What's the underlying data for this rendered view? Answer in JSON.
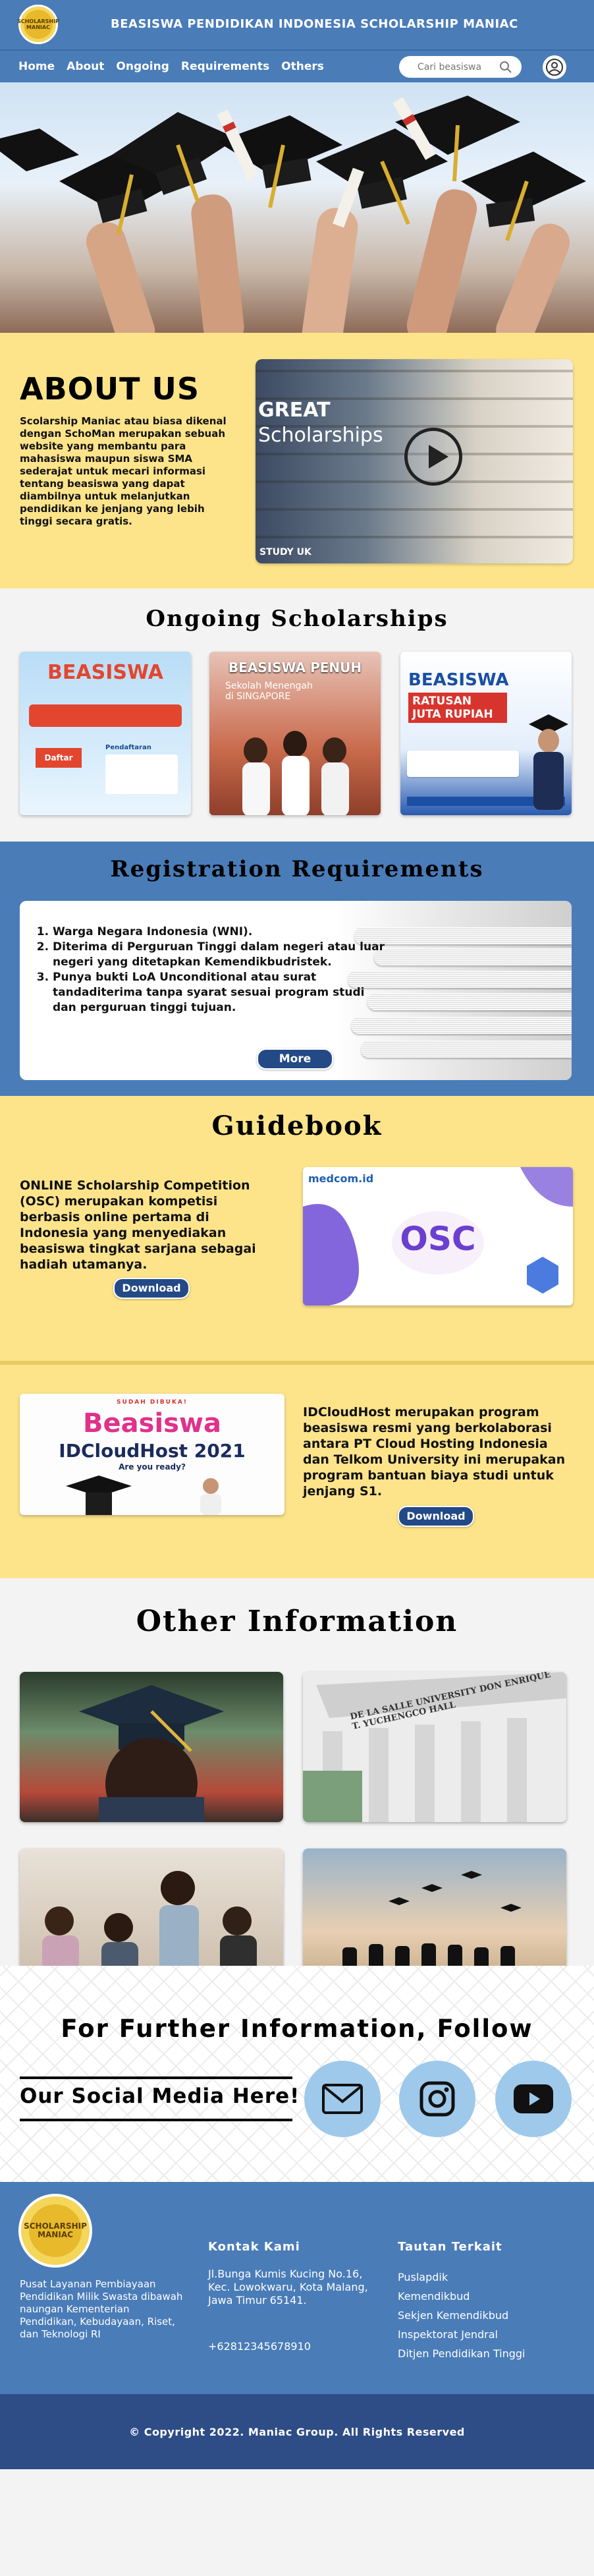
{
  "header": {
    "logo_text": "SCHOLARSHIP MANIAC",
    "site_title": "BEASISWA PENDIDIKAN INDONESIA SCHOLARSHIP MANIAC"
  },
  "nav": {
    "items": [
      "Home",
      "About",
      "Ongoing",
      "Requirements",
      "Others"
    ],
    "search_placeholder": "Cari beasiswa"
  },
  "about": {
    "title": "ABOUT US",
    "description": "Scolarship Maniac atau biasa dikenal dengan SchoMan merupakan sebuah website yang membantu para mahasiswa maupun siswa SMA sederajat untuk mecari informasi tentang beasiswa yang dapat diambilnya untuk melanjutkan pendidikan ke jenjang yang lebih tinggi secara gratis.",
    "video": {
      "line1": "GREAT",
      "line2": "Scholarships",
      "brand": "STUDY UK"
    }
  },
  "ongoing": {
    "title": "Ongoing Scholarships",
    "posters": [
      {
        "title": "BEASISWA",
        "subtitle": "Daftar",
        "sub2": "Pendaftaran"
      },
      {
        "title": "BEASISWA PENUH",
        "subtitle": "Sekolah Menengah di SINGAPORE"
      },
      {
        "title": "BEASISWA",
        "subtitle": "RATUSAN JUTA RUPIAH"
      }
    ]
  },
  "registration": {
    "title": "Registration Requirements",
    "items": [
      "Warga Negara Indonesia (WNI).",
      "Diterima di Perguruan Tinggi dalam negeri atau luar negeri yang ditetapkan Kemendikbudristek.",
      "Punya bukti LoA Unconditional atau surat tandaditerima tanpa syarat sesuai program studi dan perguruan tinggi tujuan."
    ],
    "more_label": "More"
  },
  "guidebook": {
    "title": "Guidebook",
    "item1": {
      "text": "ONLINE Scholarship Competition (OSC) merupakan kompetisi berbasis online pertama di Indonesia yang menyediakan beasiswa tingkat sarjana sebagai hadiah utamanya.",
      "button": "Download",
      "image_brand": "medcom.id",
      "image_title": "OSC"
    },
    "item2": {
      "text": "IDCloudHost merupakan program beasiswa resmi yang berkolaborasi antara PT Cloud Hosting Indonesia dan Telkom University ini merupakan program bantuan biaya studi untuk jenjang S1.",
      "button": "Download",
      "image_kicker": "SUDAH DIBUKA!",
      "image_title": "Beasiswa",
      "image_subtitle": "IDCloudHost 2021",
      "image_tagline": "Are you ready?"
    }
  },
  "other": {
    "title": "Other Information",
    "photo_sign": "DE LA SALLE UNIVERSITY DON ENRIQUE T. YUCHENGCO HALL"
  },
  "follow": {
    "title": "For Further Information, Follow",
    "subtitle": "Our Social Media Here!"
  },
  "footer": {
    "logo_text": "SCHOLARSHIP MANIAC",
    "description": "Pusat Layanan Pembiayaan Pendidikan Milik Swasta dibawah naungan Kementerian Pendidikan, Kebudayaan, Riset, dan Teknologi RI",
    "contact_title": "Kontak Kami",
    "address": "Jl.Bunga Kumis Kucing No.16, Kec. Lowokwaru, Kota Malang, Jawa Timur 65141.",
    "phone": "+62812345678910",
    "links_title": "Tautan Terkait",
    "links": [
      "Puslapdik",
      "Kemendikbud",
      "Sekjen Kemendikbud",
      "Inspektorat Jendral",
      "Ditjen Pendidikan Tinggi"
    ],
    "copyright": "© Copyright 2022. Maniac Group. All Rights Reserved"
  },
  "colors": {
    "primary": "#4a7cb8",
    "accent": "#fde48a",
    "dark": "#2e4d86",
    "button": "#234a86"
  }
}
